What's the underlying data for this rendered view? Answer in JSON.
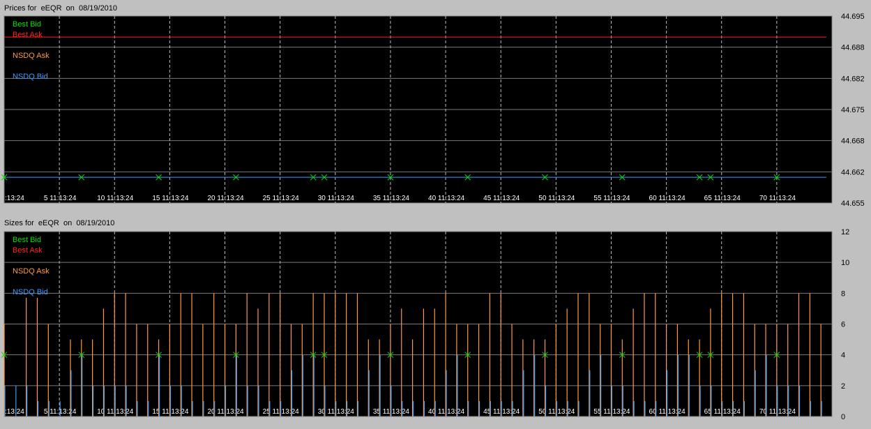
{
  "charts": {
    "prices_title": "Prices for  eEQR  on  08/19/2010",
    "sizes_title": "Sizes for  eEQR  on  08/19/2010"
  },
  "colors": {
    "best_bid": "#00e000",
    "best_ask": "#ff2020",
    "nsdq_ask": "#ff9a40",
    "nsdq_bid": "#3a9cff",
    "background": "#000000",
    "grid": "#7a7a7a",
    "text": "#ffffff"
  },
  "chart_data": [
    {
      "type": "line",
      "title": "Prices for  eEQR  on  08/19/2010",
      "legend": [
        "Best Bid",
        "Best Ask",
        "NSDQ Ask",
        "NSDQ Bid"
      ],
      "legend_position": "top-left",
      "x_tick_labels": [
        ":13:24",
        "5 11:13:24",
        "10 11:13:24",
        "15 11:13:24",
        "20 11:13:24",
        "25 11:13:24",
        "30 11:13:24",
        "35 11:13:24",
        "40 11:13:24",
        "45 11:13:24",
        "50 11:13:24",
        "55 11:13:24",
        "60 11:13:24",
        "65 11:13:24",
        "70 11:13:24"
      ],
      "x_ticks": [
        0,
        5,
        10,
        15,
        20,
        25,
        30,
        35,
        40,
        45,
        50,
        55,
        60,
        65,
        70
      ],
      "xlim": [
        0,
        75
      ],
      "y_tick_labels": [
        "44.695",
        "44.688",
        "44.682",
        "44.675",
        "44.668",
        "44.662",
        "44.655"
      ],
      "ylim": [
        44.655,
        44.695
      ],
      "grid": true,
      "series": [
        {
          "name": "Best Ask",
          "x": [
            0,
            74.5
          ],
          "y": [
            44.6905,
            44.6905
          ]
        },
        {
          "name": "NSDQ Bid",
          "x": [
            0,
            74.5
          ],
          "y": [
            44.6605,
            44.6605
          ]
        },
        {
          "name": "Best Bid",
          "marker": "x",
          "x": [
            0,
            7,
            14,
            21,
            28,
            29,
            35,
            42,
            49,
            56,
            63,
            64,
            70
          ],
          "y": [
            44.6605,
            44.6605,
            44.6605,
            44.6605,
            44.6605,
            44.6605,
            44.6605,
            44.6605,
            44.6605,
            44.6605,
            44.6605,
            44.6605,
            44.6605
          ]
        }
      ]
    },
    {
      "type": "bar",
      "title": "Sizes for  eEQR  on  08/19/2010",
      "legend": [
        "Best Bid",
        "Best Ask",
        "NSDQ Ask",
        "NSDQ Bid"
      ],
      "legend_position": "top-left",
      "x_tick_labels": [
        ":13:24",
        "5 11:13:24",
        "10 11:13:24",
        "15 11:13:24",
        "20 11:13:24",
        "25 11:13:24",
        "30 11:13:24",
        "35 11:13:24",
        "40 11:13:24",
        "45 11:13:24",
        "50 11:13:24",
        "55 11:13:24",
        "60 11:13:24",
        "65 11:13:24",
        "70 11:13:24"
      ],
      "x_ticks": [
        0,
        5,
        10,
        15,
        20,
        25,
        30,
        35,
        40,
        45,
        50,
        55,
        60,
        65,
        70
      ],
      "xlim": [
        0,
        75
      ],
      "y_tick_labels": [
        "12",
        "10",
        "8",
        "6",
        "4",
        "2",
        "0"
      ],
      "ylim": [
        0,
        12
      ],
      "grid": true,
      "series": [
        {
          "name": "NSDQ Ask",
          "x": [
            0,
            2,
            3,
            4,
            6,
            7,
            8,
            9,
            10,
            11,
            12,
            13,
            14,
            15,
            16,
            17,
            18,
            19,
            20,
            21,
            22,
            23,
            24,
            25,
            26,
            27,
            28,
            29,
            30,
            31,
            32,
            33,
            34,
            35,
            36,
            37,
            38,
            39,
            40,
            41,
            42,
            43,
            44,
            45,
            46,
            47,
            48,
            49,
            50,
            51,
            52,
            53,
            54,
            55,
            56,
            57,
            58,
            59,
            60,
            61,
            62,
            63,
            64,
            65,
            66,
            67,
            68,
            69,
            70,
            71,
            72,
            73,
            74
          ],
          "y": [
            6,
            7.7,
            7.7,
            6,
            5,
            5,
            5,
            7,
            8,
            8,
            6,
            6,
            5,
            6,
            8,
            8,
            6,
            8,
            6,
            6,
            8,
            7,
            8,
            8,
            6,
            6,
            8,
            8,
            8,
            8,
            8,
            5,
            5,
            6,
            7,
            5,
            7,
            7,
            8,
            6,
            6,
            6,
            8,
            8,
            6,
            5,
            5,
            5,
            6,
            7,
            8,
            8,
            6,
            6,
            5,
            7,
            8,
            8,
            6,
            6,
            5,
            5,
            7,
            8,
            8,
            8,
            6,
            6,
            6,
            6,
            8,
            8,
            6
          ]
        },
        {
          "name": "NSDQ Bid",
          "x": [
            0,
            1,
            2,
            3,
            4,
            5,
            6,
            7,
            8,
            9,
            10,
            11,
            12,
            13,
            14,
            15,
            16,
            17,
            18,
            19,
            20,
            21,
            22,
            23,
            24,
            25,
            26,
            27,
            28,
            29,
            30,
            31,
            32,
            33,
            34,
            35,
            36,
            37,
            38,
            39,
            40,
            41,
            42,
            43,
            44,
            45,
            46,
            47,
            48,
            49,
            50,
            51,
            52,
            53,
            54,
            55,
            56,
            57,
            58,
            59,
            60,
            61,
            62,
            63,
            64,
            65,
            66,
            67,
            68,
            69,
            70,
            71,
            72,
            73,
            74
          ],
          "y": [
            2,
            2,
            2,
            1,
            1,
            1,
            3,
            4,
            2,
            2,
            2,
            2,
            1,
            1,
            4,
            2,
            2,
            1,
            1,
            1,
            2,
            4,
            2,
            2,
            1,
            1,
            3,
            4,
            4,
            2,
            1,
            1,
            1,
            3,
            4,
            2,
            1,
            1,
            1,
            1,
            3,
            4,
            1,
            1,
            1,
            1,
            1,
            3,
            4,
            2,
            1,
            1,
            1,
            3,
            4,
            2,
            2,
            1,
            1,
            1,
            3,
            4,
            4,
            2,
            2,
            1,
            1,
            1,
            3,
            4,
            2,
            2,
            2,
            1,
            1
          ]
        },
        {
          "name": "Best Bid",
          "marker": "x",
          "x": [
            0,
            7,
            14,
            21,
            28,
            29,
            35,
            42,
            49,
            56,
            63,
            64,
            70
          ],
          "y": [
            4,
            4,
            4,
            4,
            4,
            4,
            4,
            4,
            4,
            4,
            4,
            4,
            4
          ]
        }
      ]
    }
  ]
}
